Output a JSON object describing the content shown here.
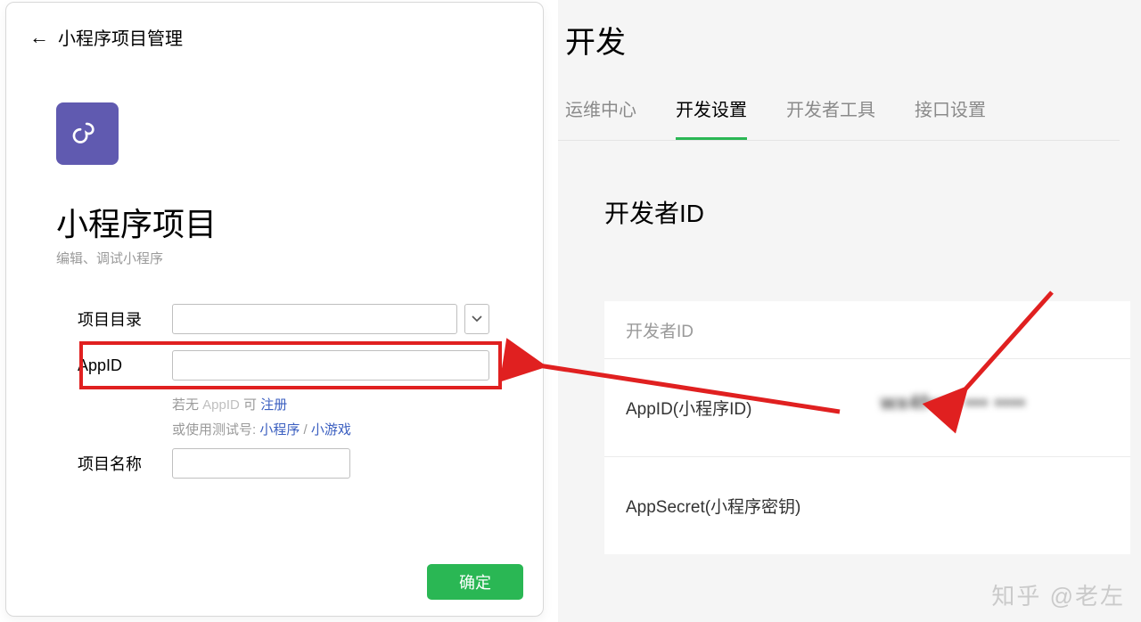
{
  "left": {
    "header_title": "小程序项目管理",
    "section_title": "小程序项目",
    "section_subtitle": "编辑、调试小程序",
    "labels": {
      "project_dir": "项目目录",
      "app_id": "AppID",
      "project_name": "项目名称"
    },
    "hints": {
      "no_appid_prefix": "若无 ",
      "no_appid_gray": "AppID",
      "no_appid_suffix": " 可 ",
      "register": "注册",
      "use_test_prefix": "或使用测试号: ",
      "mini_program": "小程序",
      "slash": " / ",
      "mini_game": "小游戏"
    },
    "confirm": "确定"
  },
  "right": {
    "title": "开发",
    "tabs": [
      "运维中心",
      "开发设置",
      "开发者工具",
      "接口设置"
    ],
    "active_tab_index": 1,
    "section_title": "开发者ID",
    "table": {
      "header": "开发者ID",
      "rows": [
        {
          "label": "AppID(小程序ID)",
          "value_blurred": "wx4f•••• ••• ••••"
        },
        {
          "label": "AppSecret(小程序密钥)"
        }
      ]
    }
  },
  "watermark": "知乎 @老左",
  "colors": {
    "accent_green": "#2ab754",
    "accent_red": "#e02020",
    "icon_purple": "#605ab0",
    "link_blue": "#3b5fc0"
  }
}
